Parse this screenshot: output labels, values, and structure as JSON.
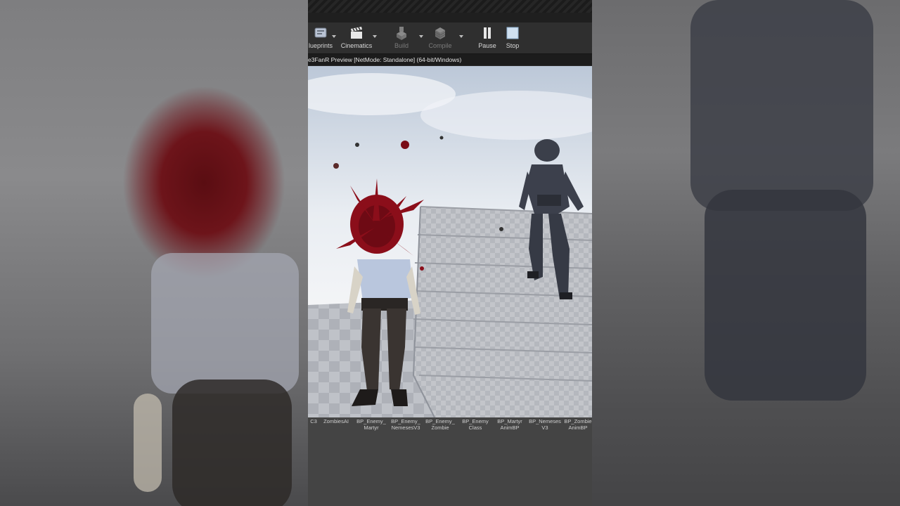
{
  "window": {
    "status_text": "e3FanR Preview [NetMode: Standalone]  (64-bit/Windows)"
  },
  "toolbar": {
    "items": [
      {
        "label": "lueprints",
        "icon": "blueprints-icon",
        "enabled": true,
        "has_menu": true
      },
      {
        "label": "Cinematics",
        "icon": "clapperboard-icon",
        "enabled": true,
        "has_menu": true
      },
      {
        "label": "Build",
        "icon": "build-icon",
        "enabled": false,
        "has_menu": true
      },
      {
        "label": "Compile",
        "icon": "compile-icon",
        "enabled": false,
        "has_menu": true
      },
      {
        "label": "Pause",
        "icon": "pause-icon",
        "enabled": true,
        "has_menu": false
      },
      {
        "label": "Stop",
        "icon": "stop-icon",
        "enabled": true,
        "has_menu": false
      }
    ]
  },
  "viewport": {
    "scene": "game-preview",
    "blood_color": "#8b0e1a"
  },
  "content_browser": {
    "assets": [
      {
        "label": "C3"
      },
      {
        "label": "ZombiesAI"
      },
      {
        "label": "BP_Enemy_\nMartyr"
      },
      {
        "label": "BP_Enemy_\nNemesesV3"
      },
      {
        "label": "BP_Enemy_\nZombie"
      },
      {
        "label": "BP_Enemy\nClass"
      },
      {
        "label": "BP_Martyr\nAnimBP"
      },
      {
        "label": "BP_Nemeses\nV3"
      },
      {
        "label": "BP_Zombie\nAnimBP"
      }
    ]
  }
}
